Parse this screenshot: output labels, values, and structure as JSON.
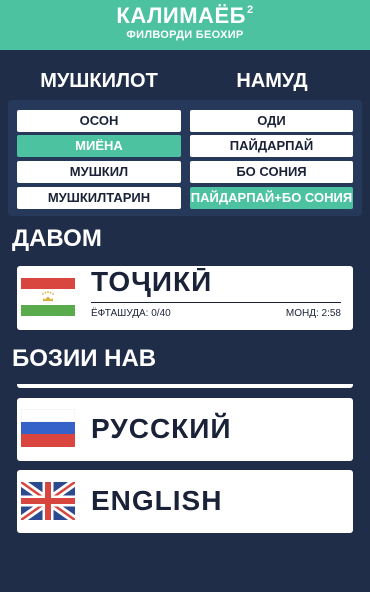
{
  "header": {
    "title": "КАЛИМАЁБ",
    "title_superscript": "2",
    "subtitle": "ФИЛВОРДИ БЕОХИР"
  },
  "difficulty": {
    "heading": "МУШКИЛОТ",
    "options": [
      {
        "label": "ОСОН",
        "selected": false
      },
      {
        "label": "МИЁНА",
        "selected": true
      },
      {
        "label": "МУШКИЛ",
        "selected": false
      },
      {
        "label": "МУШКИЛТАРИН",
        "selected": false
      }
    ]
  },
  "word_type": {
    "heading": "НАМУД",
    "options": [
      {
        "label": "ОДИ",
        "selected": false
      },
      {
        "label": "ПАЙДАРПАЙ",
        "selected": false
      },
      {
        "label": "БО СОНИЯ",
        "selected": false
      },
      {
        "label": "ПАЙДАРПАЙ+БО СОНИЯ",
        "selected": true
      }
    ]
  },
  "continue": {
    "section_title": "ДАВОМ",
    "game": {
      "language": "ТОҶИКӢ",
      "found": "ЁФТАШУДА: 0/40",
      "time": "МОНД: 2:58",
      "flag": "tajikistan-flag"
    }
  },
  "new_game": {
    "section_title": "БОЗИИ НАВ",
    "languages": [
      {
        "name": "РУССКИЙ",
        "flag": "russia-flag"
      },
      {
        "name": "ENGLISH",
        "flag": "uk-flag"
      }
    ]
  },
  "colors": {
    "background": "#1f2d48",
    "accent": "#4dc2a0",
    "panel": "#27395b",
    "card": "#ffffff",
    "text_dark": "#1a2238"
  }
}
